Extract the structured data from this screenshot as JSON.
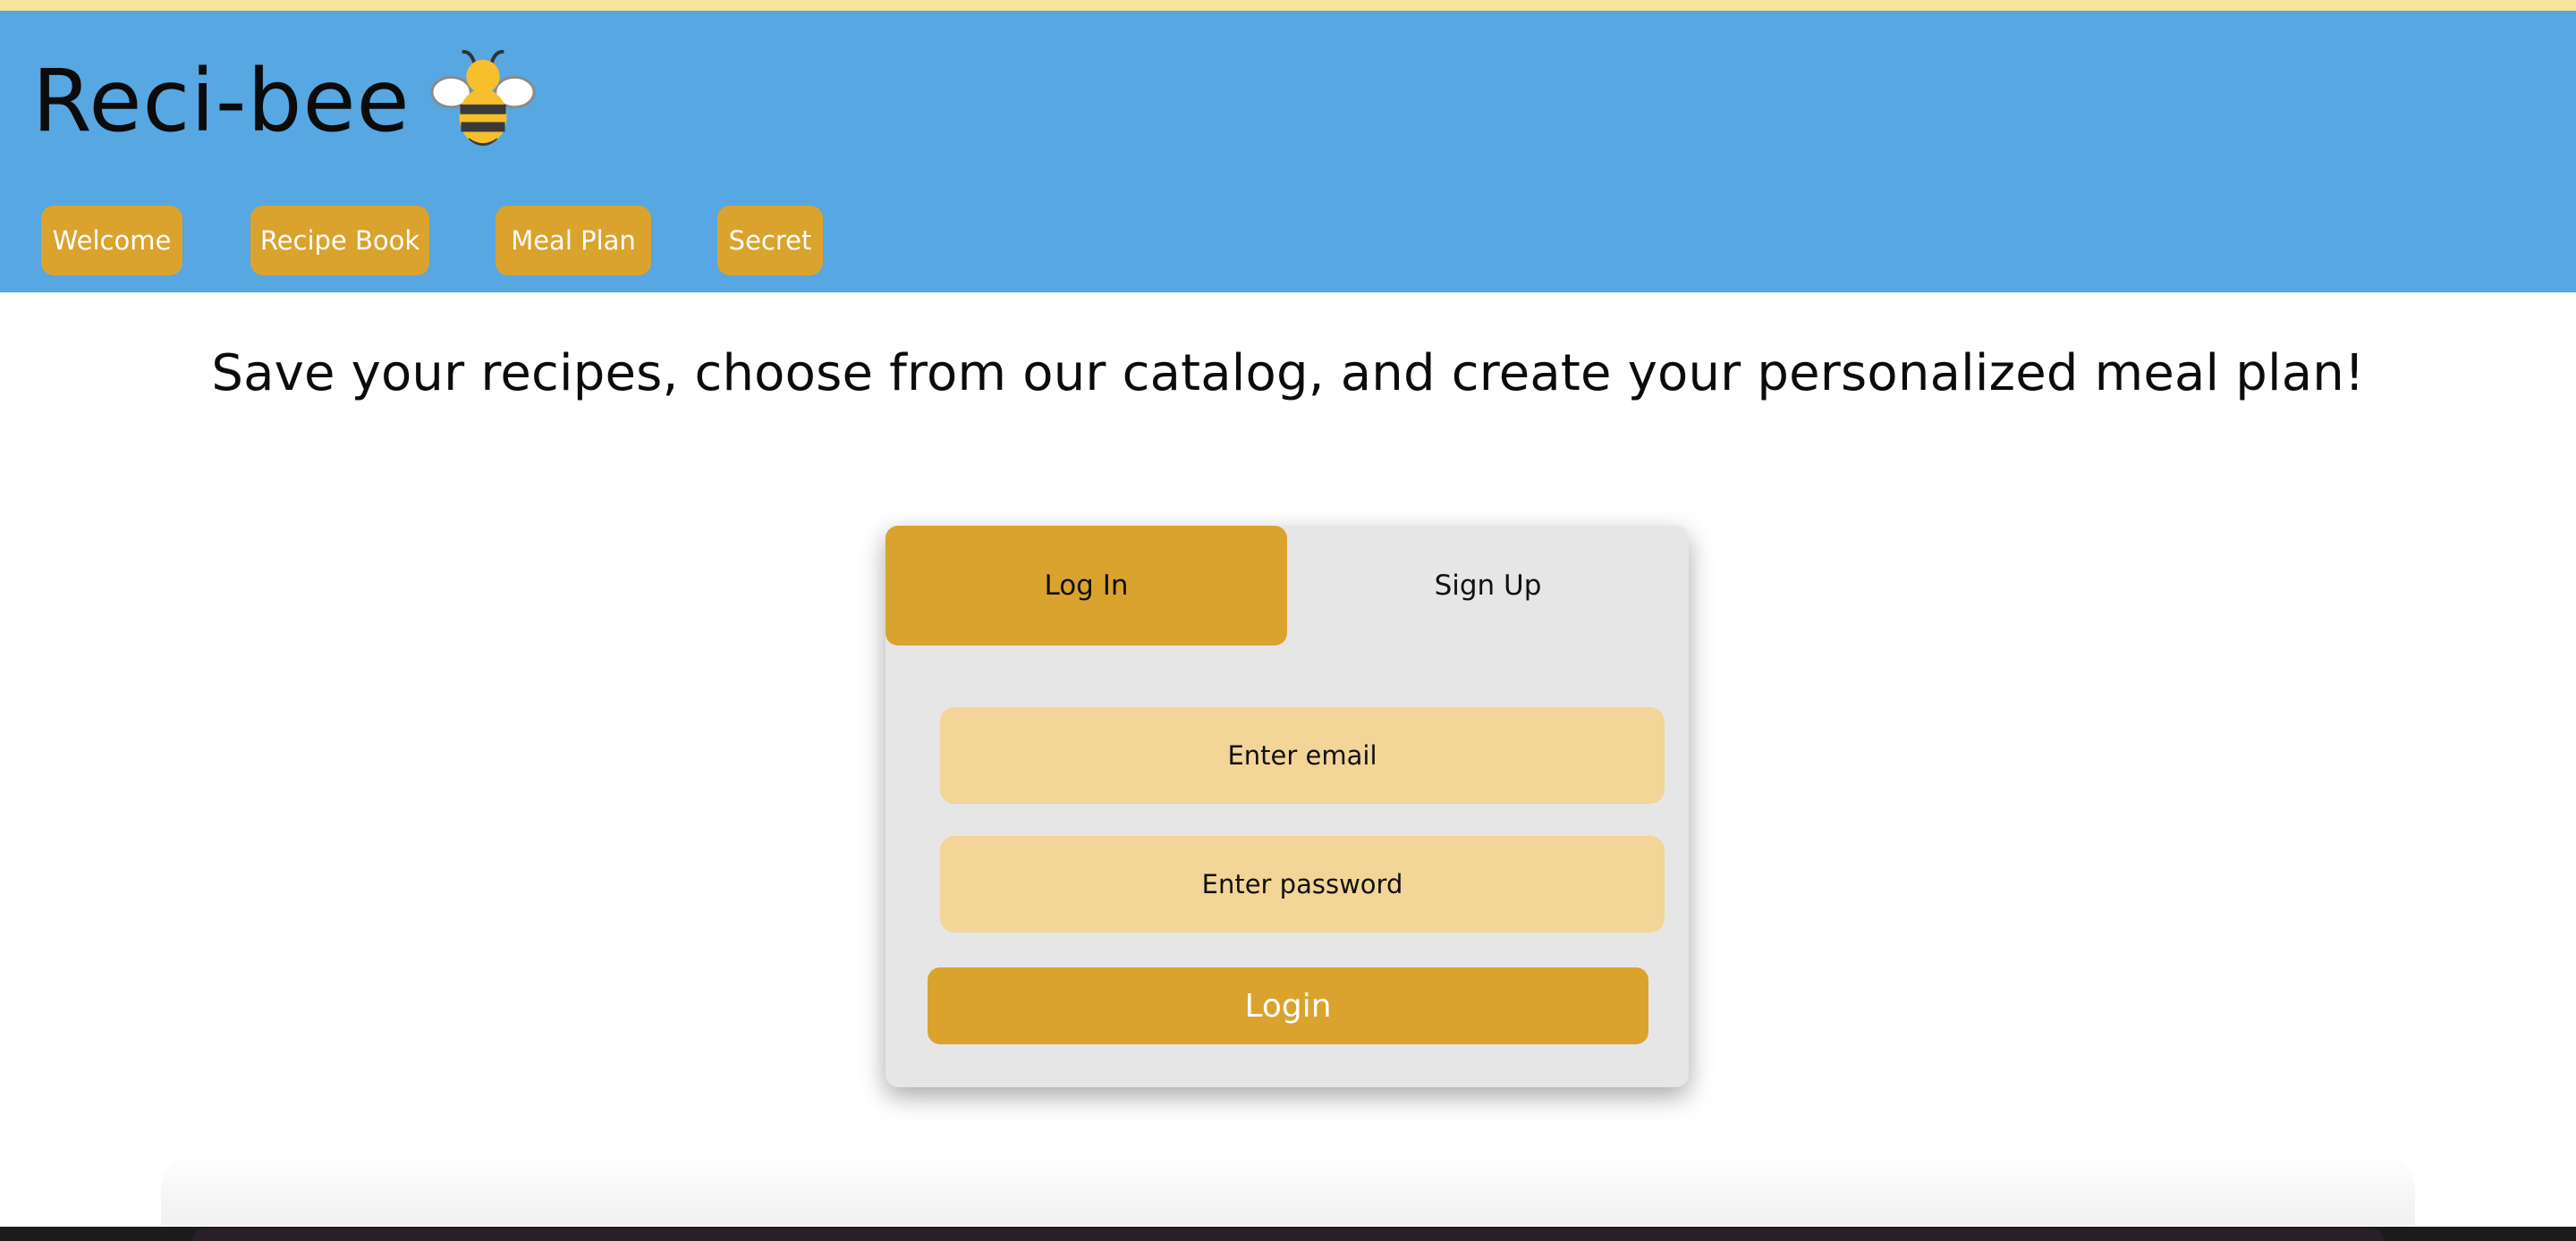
{
  "app": {
    "title": "Reci-bee",
    "logo_icon": "bee-icon"
  },
  "nav": {
    "items": [
      {
        "label": "Welcome"
      },
      {
        "label": "Recipe Book"
      },
      {
        "label": "Meal Plan"
      },
      {
        "label": "Secret"
      }
    ]
  },
  "tagline": "Save your recipes, choose from our catalog, and create your personalized meal plan!",
  "auth": {
    "tabs": [
      {
        "label": "Log In",
        "active": true
      },
      {
        "label": "Sign Up",
        "active": false
      }
    ],
    "email": {
      "value": "",
      "placeholder": "Enter email"
    },
    "password": {
      "value": "",
      "placeholder": "Enter password"
    },
    "submit_label": "Login"
  },
  "colors": {
    "header": "#56a7e2",
    "top_stripe": "#f8e49a",
    "accent": "#daa32d",
    "field": "#f2d597",
    "card": "#e6e6e6"
  }
}
